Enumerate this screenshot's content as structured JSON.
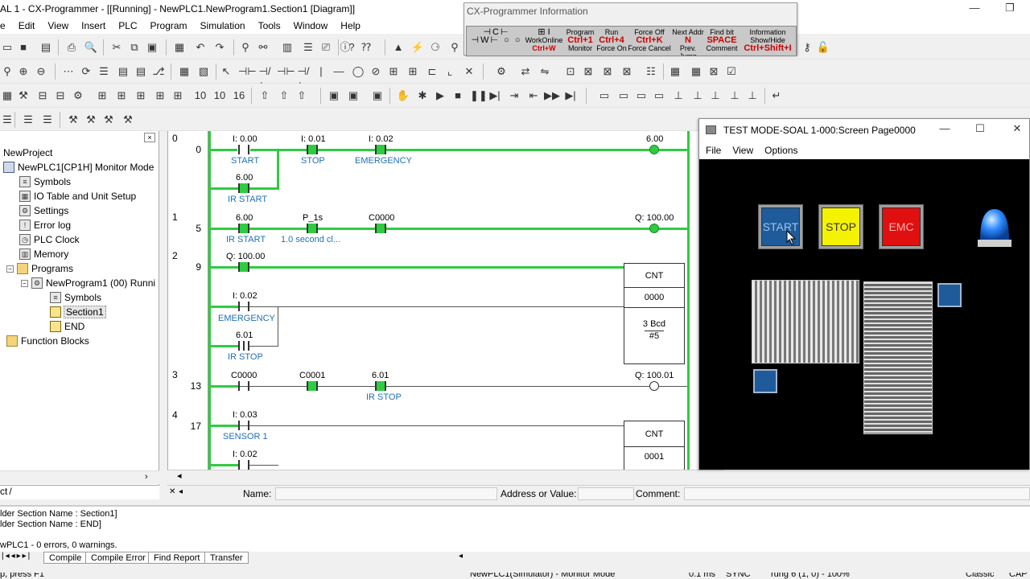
{
  "app": {
    "title": "AL 1 - CX-Programmer - [[Running] - NewPLC1.NewProgram1.Section1 [Diagram]]",
    "window_minimize": "—",
    "window_restore": "❐"
  },
  "menu": [
    "e",
    "Edit",
    "View",
    "Insert",
    "PLC",
    "Program",
    "Simulation",
    "Tools",
    "Window",
    "Help"
  ],
  "tree": {
    "root": "NewProject",
    "plc": "NewPLC1[CP1H] Monitor Mode",
    "items": [
      "Symbols",
      "IO Table and Unit Setup",
      "Settings",
      "Error log",
      "PLC Clock",
      "Memory",
      "Programs"
    ],
    "program": "NewProgram1 (00) Runni",
    "program_items": [
      "Symbols",
      "Section1",
      "END"
    ],
    "function_blocks": "Function Blocks",
    "close": "×",
    "tab": "ct"
  },
  "ladder": {
    "rungs": [
      {
        "index": "0",
        "step": "0"
      },
      {
        "index": "1",
        "step": "5"
      },
      {
        "index": "2",
        "step": "9"
      },
      {
        "index": "3",
        "step": "13"
      },
      {
        "index": "4",
        "step": "17"
      }
    ],
    "r0": {
      "a1": "I: 0.00",
      "c1": "START",
      "a2": "I: 0.01",
      "c2": "STOP",
      "a3": "I: 0.02",
      "c3": "EMERGENCY",
      "a4": "6.00",
      "c4": "IR START",
      "coil": "6.00"
    },
    "r1": {
      "a1": "6.00",
      "c1": "IR START",
      "a2": "P_1s",
      "c2": "1.0 second cl...",
      "a3": "C0000",
      "coil": "Q: 100.00"
    },
    "r2": {
      "a1": "Q: 100.00",
      "a2": "I: 0.02",
      "c2": "EMERGENCY",
      "a3": "6.01",
      "c3": "IR STOP",
      "blk_title": "CNT",
      "blk_num": "0000",
      "blk_val": "3 Bcd",
      "blk_val2": "#5"
    },
    "r3": {
      "a1": "C0000",
      "a2": "C0001",
      "a3": "6.01",
      "c3": "IR STOP",
      "coil": "Q: 100.01"
    },
    "r4": {
      "a1": "I: 0.03",
      "c1": "SENSOR 1",
      "a2": "I: 0.02",
      "blk_title": "CNT",
      "blk_num": "0001"
    }
  },
  "infobar": {
    "name_label": "Name:",
    "addr_label": "Address or Value:",
    "comment_label": "Comment:"
  },
  "output": {
    "lines": [
      "lder Section Name : Section1]",
      "lder Section Name : END]",
      "",
      "wPLC1 - 0 errors, 0 warnings."
    ],
    "tabs": [
      "Compile",
      "Compile Error",
      "Find Report",
      "Transfer"
    ]
  },
  "status": {
    "help": "p, press F1",
    "mode": "NewPLC1(Simulator) - Monitor Mode",
    "time": "0.1 ms",
    "sync": "SYNC",
    "rung": "rung 6 (1, 0)  - 100%",
    "style": "Classic",
    "caps": "CAP"
  },
  "info_window": {
    "title": "CX-Programmer Information",
    "cells": [
      {
        "top": "Program",
        "key": "Ctrl+1",
        "bot": "Monitor"
      },
      {
        "top": "Run",
        "key": "Ctrl+4",
        "bot": "Force On"
      },
      {
        "top": "Force Off",
        "key": "Ctrl+K",
        "bot": "Force Cancel"
      },
      {
        "top": "Next Addr",
        "key": "N",
        "bot": "Prev. Jump"
      },
      {
        "top": "Find bit",
        "key": "SPACE",
        "bot": "Comment"
      },
      {
        "top": "Information Show/Hide",
        "key": "Ctrl+Shift+I",
        "bot": ""
      }
    ],
    "sym_a": "WorkOnline",
    "sym_b": "Ctrl+W"
  },
  "test_window": {
    "title": "TEST MODE-SOAL 1-000:Screen Page0000",
    "menu": [
      "File",
      "View",
      "Options"
    ],
    "buttons": {
      "start": "START",
      "stop": "STOP",
      "emc": "EMC"
    },
    "colors": {
      "start": "#1f5b9a",
      "stop": "#f5f200",
      "emc": "#e01010",
      "lamp": "#2f8bff"
    }
  }
}
